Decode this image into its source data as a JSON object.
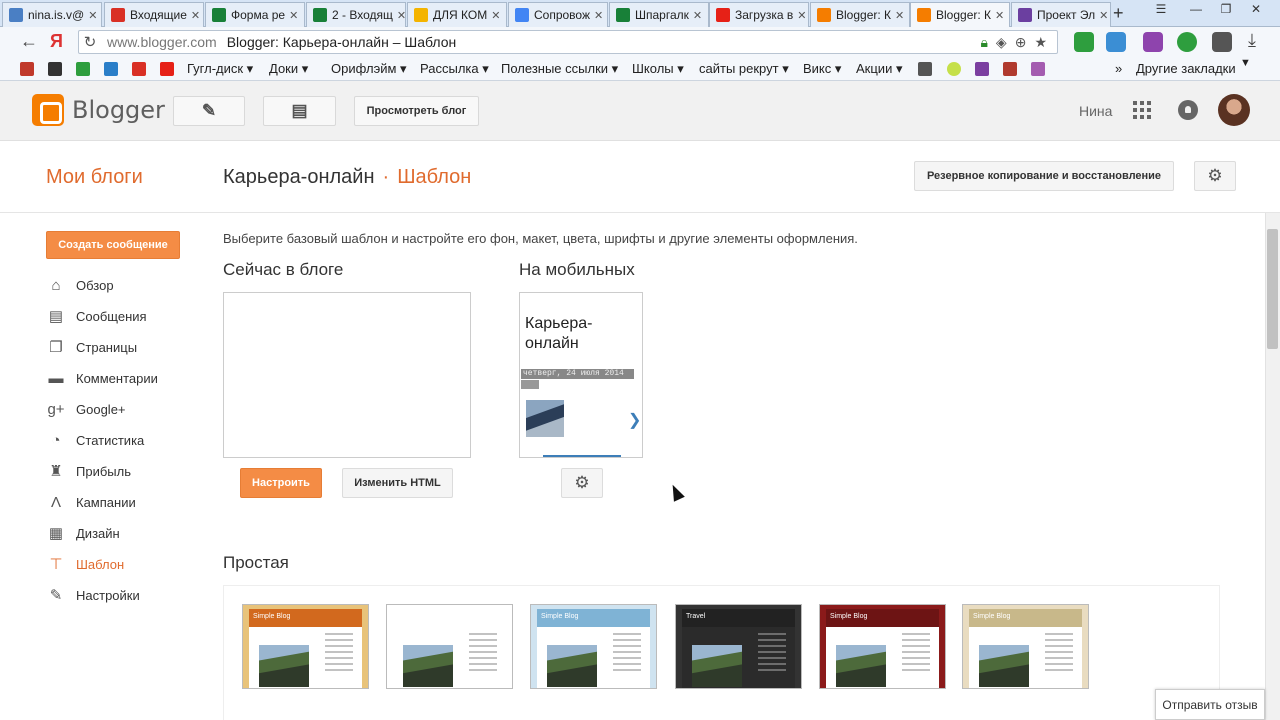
{
  "browser": {
    "tabs": [
      {
        "label": "nina.is.v@",
        "color": "#4a7fc4"
      },
      {
        "label": "Входящие",
        "color": "#d93025"
      },
      {
        "label": "Форма ре",
        "color": "#188038"
      },
      {
        "label": "2 - Входящ",
        "color": "#188038"
      },
      {
        "label": "ДЛЯ КОМ",
        "color": "#f4b400"
      },
      {
        "label": "Сопровож",
        "color": "#4285f4"
      },
      {
        "label": "Шпаргалк",
        "color": "#188038"
      },
      {
        "label": "Загрузка в",
        "color": "#e62117"
      },
      {
        "label": "Blogger: К",
        "color": "#f57d00"
      },
      {
        "label": "Blogger: К",
        "color": "#f57d00"
      },
      {
        "label": "Проект Эл",
        "color": "#6b3fa0"
      }
    ],
    "new_tab": "+",
    "window_controls": [
      "☰",
      "—",
      "❐",
      "✕"
    ],
    "nav": {
      "back": "←",
      "yandex": "Я"
    },
    "url": {
      "host": "www.blogger.com",
      "title": "Blogger: Карьера-онлайн – Шаблон"
    },
    "bookmarks": [
      "Гугл-диск ▾",
      "Доки ▾",
      "Орифлэйм ▾",
      "Рассылка ▾",
      "Полезные ссылки ▾",
      "Школы ▾",
      "сайты рекрут ▾",
      "Викс ▾",
      "Акции ▾"
    ],
    "other_bookmarks": "Другие закладки"
  },
  "header": {
    "logo_text": "Blogger",
    "view_blog_label": "Просмотреть блог",
    "user_name": "Нина"
  },
  "subheader": {
    "my_blogs": "Мои блоги",
    "blog_name": "Карьера-онлайн",
    "separator": "·",
    "section": "Шаблон",
    "backup_label": "Резервное копирование и восстановление"
  },
  "sidebar": {
    "create_post": "Создать сообщение",
    "items": [
      {
        "label": "Обзор",
        "icon": "home-icon",
        "glyph": "⌂"
      },
      {
        "label": "Сообщения",
        "icon": "posts-icon",
        "glyph": "▤"
      },
      {
        "label": "Страницы",
        "icon": "pages-icon",
        "glyph": "❐"
      },
      {
        "label": "Комментарии",
        "icon": "comment-icon",
        "glyph": "▬"
      },
      {
        "label": "Google+",
        "icon": "google-plus-icon",
        "glyph": "g+"
      },
      {
        "label": "Статистика",
        "icon": "stats-icon",
        "glyph": "◔"
      },
      {
        "label": "Прибыль",
        "icon": "trophy-icon",
        "glyph": "♜"
      },
      {
        "label": "Кампании",
        "icon": "campaign-icon",
        "glyph": "Λ"
      },
      {
        "label": "Дизайн",
        "icon": "layout-icon",
        "glyph": "▦"
      },
      {
        "label": "Шаблон",
        "icon": "template-icon",
        "glyph": "⊤"
      },
      {
        "label": "Настройки",
        "icon": "wrench-icon",
        "glyph": "✎"
      }
    ]
  },
  "main": {
    "description": "Выберите базовый шаблон и настройте его фон, макет, цвета, шрифты и другие элементы оформления.",
    "current_heading": "Сейчас в блоге",
    "mobile_heading": "На мобильных",
    "customize_label": "Настроить",
    "edit_html_label": "Изменить HTML",
    "mobile_preview": {
      "title_line1": "Карьера-",
      "title_line2": "онлайн",
      "date": "четверг, 24 июля 2014",
      "arrow": "❯"
    },
    "simple_heading": "Простая",
    "templates": [
      {
        "title": "Simple Blog",
        "band": "#d2691e",
        "bg": "#e8c37a"
      },
      {
        "title": "",
        "band": "#ffffff",
        "bg": "#ffffff"
      },
      {
        "title": "Simple Blog",
        "band": "#7fb3d5",
        "bg": "#cfe3f0"
      },
      {
        "title": "Travel",
        "band": "#222222",
        "bg": "#333333"
      },
      {
        "title": "Simple Blog",
        "band": "#6d1414",
        "bg": "#8b1a1a"
      },
      {
        "title": "Simple Blog",
        "band": "#c8b88a",
        "bg": "#e9dcc0"
      }
    ]
  },
  "feedback_label": "Отправить отзыв"
}
